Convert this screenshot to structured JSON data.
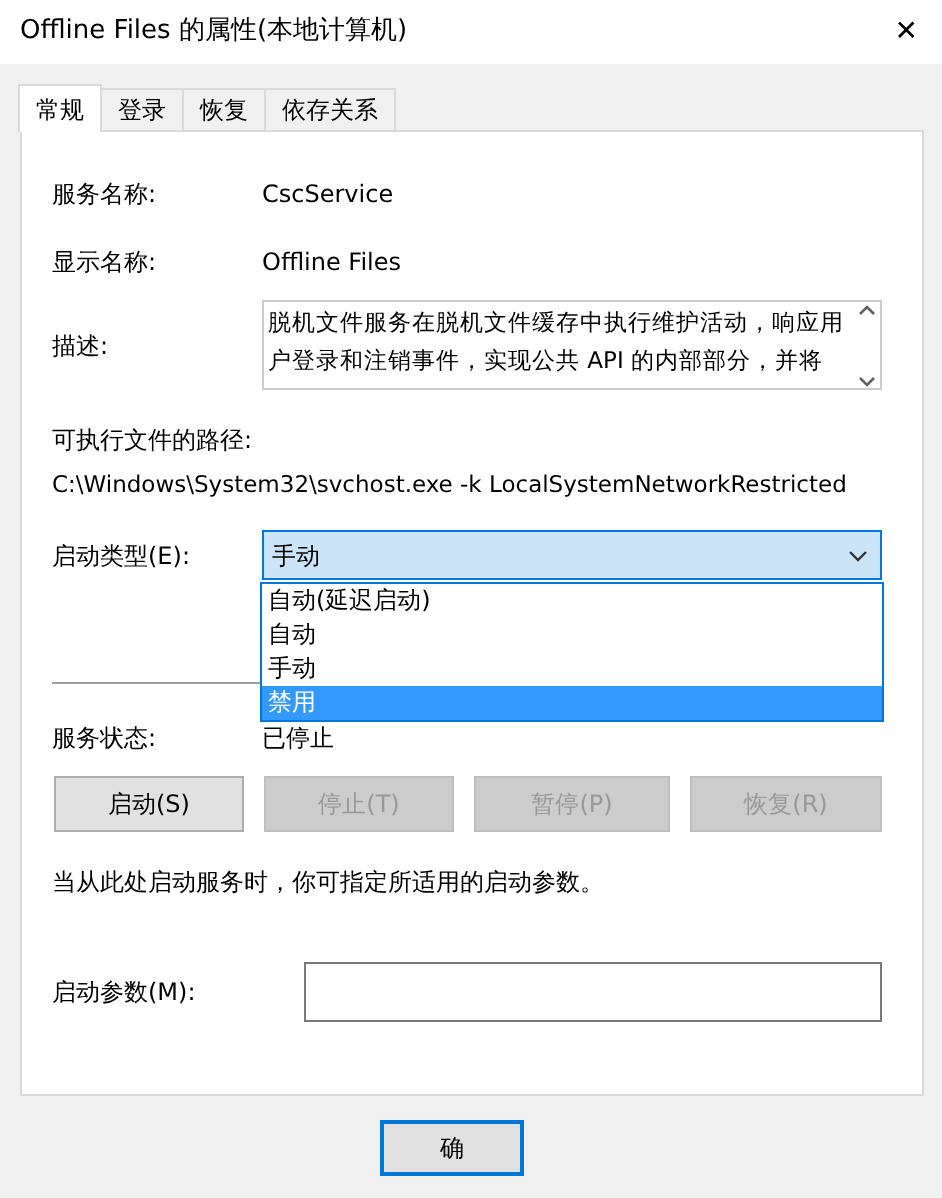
{
  "window": {
    "title": "Offline Files 的属性(本地计算机)",
    "close": "✕"
  },
  "tabs": [
    {
      "label": "常规",
      "selected": true
    },
    {
      "label": "登录",
      "selected": false
    },
    {
      "label": "恢复",
      "selected": false
    },
    {
      "label": "依存关系",
      "selected": false
    }
  ],
  "service_name": {
    "label": "服务名称:",
    "value": "CscService"
  },
  "display_name": {
    "label": "显示名称:",
    "value": "Offline Files"
  },
  "description": {
    "label": "描述:",
    "value": "脱机文件服务在脱机文件缓存中执行维护活动，响应用户登录和注销事件，实现公共 API 的内部部分，并将"
  },
  "path": {
    "label": "可执行文件的路径:",
    "value": "C:\\Windows\\System32\\svchost.exe -k LocalSystemNetworkRestricted"
  },
  "startup_type": {
    "label": "启动类型(E):",
    "value": "手动",
    "expanded": true,
    "options": [
      {
        "label": "自动(延迟启动)",
        "highlighted": false
      },
      {
        "label": "自动",
        "highlighted": false
      },
      {
        "label": "手动",
        "highlighted": false
      },
      {
        "label": "禁用",
        "highlighted": true
      }
    ]
  },
  "service_status": {
    "label": "服务状态:",
    "value": "已停止"
  },
  "service_buttons": [
    {
      "label": "启动(S)",
      "disabled": false
    },
    {
      "label": "停止(T)",
      "disabled": true
    },
    {
      "label": "暂停(P)",
      "disabled": true
    },
    {
      "label": "恢复(R)",
      "disabled": true
    }
  ],
  "hint": "当从此处启动服务时，你可指定所适用的启动参数。",
  "start_params": {
    "label": "启动参数(M):"
  },
  "footer_buttons": [
    {
      "label": "确"
    }
  ]
}
